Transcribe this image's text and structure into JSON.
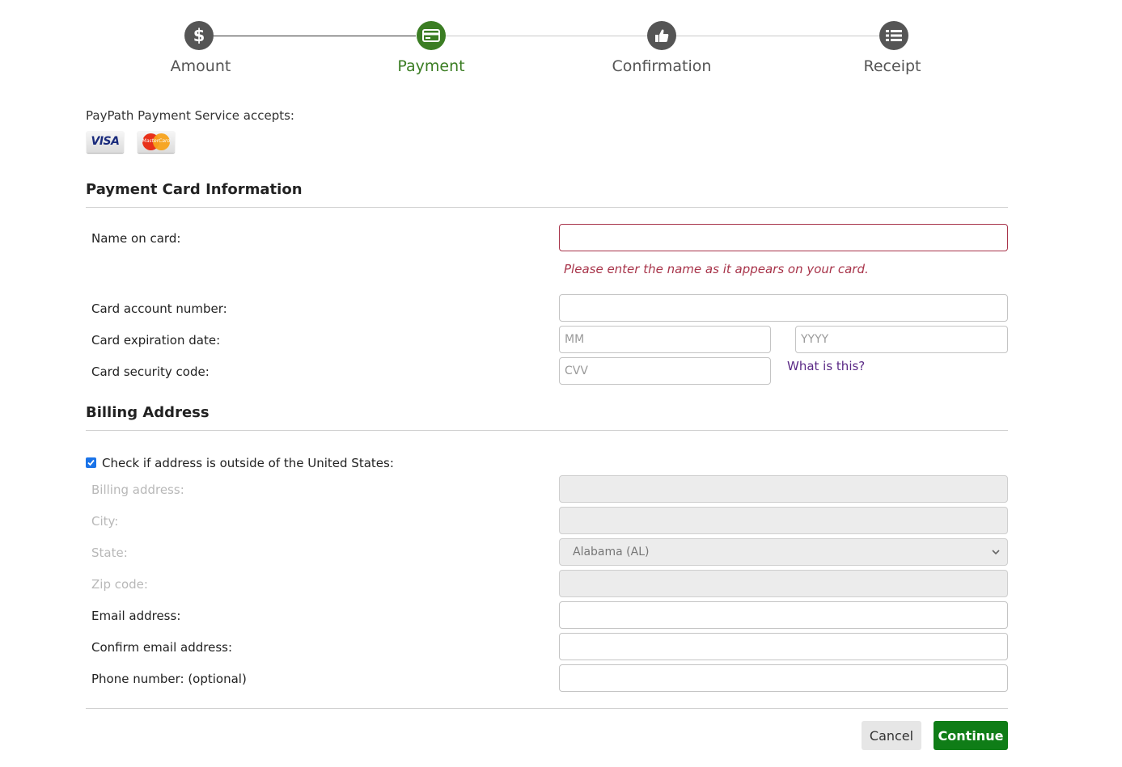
{
  "steps": [
    {
      "label": "Amount",
      "icon": "dollar-icon",
      "state": "done"
    },
    {
      "label": "Payment",
      "icon": "credit-card-icon",
      "state": "active"
    },
    {
      "label": "Confirmation",
      "icon": "thumbs-up-icon",
      "state": "pending"
    },
    {
      "label": "Receipt",
      "icon": "list-icon",
      "state": "pending"
    }
  ],
  "accepts": {
    "text": "PayPath Payment Service accepts:",
    "cards": [
      {
        "name": "VISA",
        "icon": "visa-logo"
      },
      {
        "name": "MasterCard",
        "icon": "mastercard-logo"
      }
    ]
  },
  "card_section": {
    "title": "Payment Card Information",
    "name_label": "Name on card:",
    "name_value": "",
    "name_error": "Please enter the name as it appears on your card.",
    "number_label": "Card account number:",
    "number_value": "",
    "expiration_label": "Card expiration date:",
    "month_placeholder": "MM",
    "year_placeholder": "YYYY",
    "security_label": "Card security code:",
    "cvv_placeholder": "CVV",
    "what_is_this": "What is this?"
  },
  "billing_section": {
    "title": "Billing Address",
    "outside_us_label": "Check if address is outside of the United States:",
    "outside_us_checked": true,
    "address_label": "Billing address:",
    "city_label": "City:",
    "state_label": "State:",
    "state_value": "Alabama (AL)",
    "zip_label": "Zip code:",
    "email_label": "Email address:",
    "confirm_email_label": "Confirm email address:",
    "phone_label": "Phone number: (optional)"
  },
  "actions": {
    "cancel_label": "Cancel",
    "continue_label": "Continue"
  },
  "colors": {
    "accent_green": "#3b7d23",
    "continue_green": "#0f7d17",
    "error_red": "#a8344a",
    "link_purple": "#5b2a86"
  }
}
